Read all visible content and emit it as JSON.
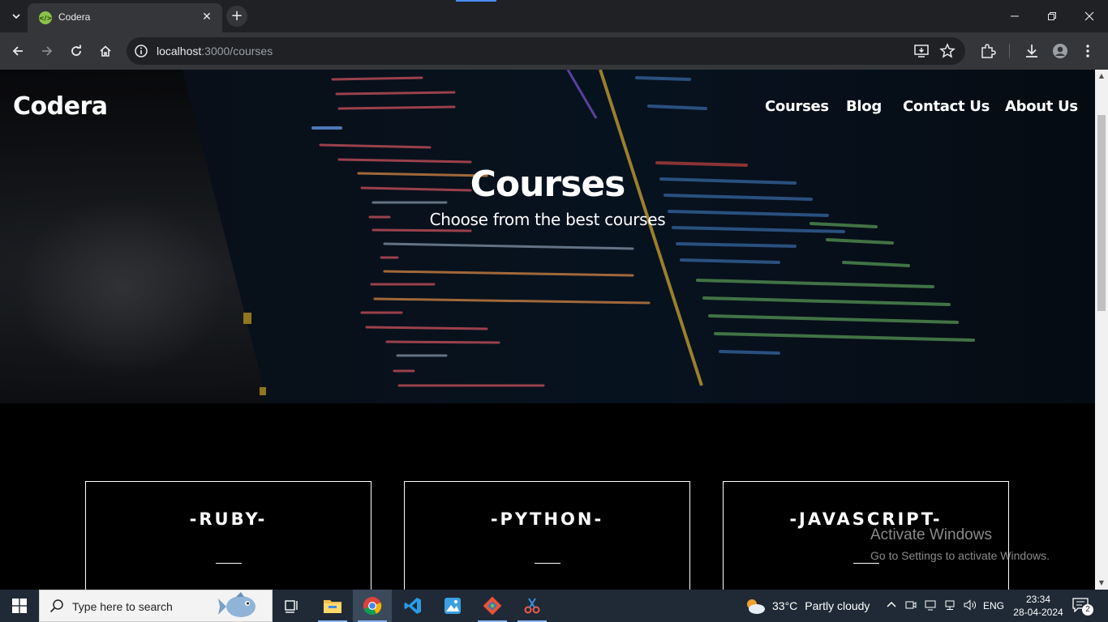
{
  "browser": {
    "tab_title": "Codera",
    "favicon": "code-icon",
    "url_host": "localhost",
    "url_path": ":3000/courses",
    "accent_color": "#4a8df8"
  },
  "site": {
    "logo": "Codera",
    "nav": {
      "courses": "Courses",
      "blog": "Blog",
      "contact": "Contact Us",
      "about": "About Us"
    },
    "hero": {
      "title": "Courses",
      "subtitle": "Choose from the best courses"
    },
    "cards": [
      {
        "title": "-RUBY-"
      },
      {
        "title": "-PYTHON-"
      },
      {
        "title": "-JAVASCRIPT-"
      }
    ]
  },
  "watermark": {
    "title": "Activate Windows",
    "subtitle": "Go to Settings to activate Windows."
  },
  "taskbar": {
    "search_placeholder": "Type here to search",
    "weather_temp": "33°C",
    "weather_desc": "Partly cloudy",
    "language": "ENG",
    "time": "23:34",
    "date": "28-04-2024",
    "notification_count": "2",
    "apps": [
      "task-view-icon",
      "file-explorer-icon",
      "chrome-icon",
      "vscode-icon",
      "paint-icon",
      "git-icon",
      "snipping-tool-icon"
    ]
  }
}
